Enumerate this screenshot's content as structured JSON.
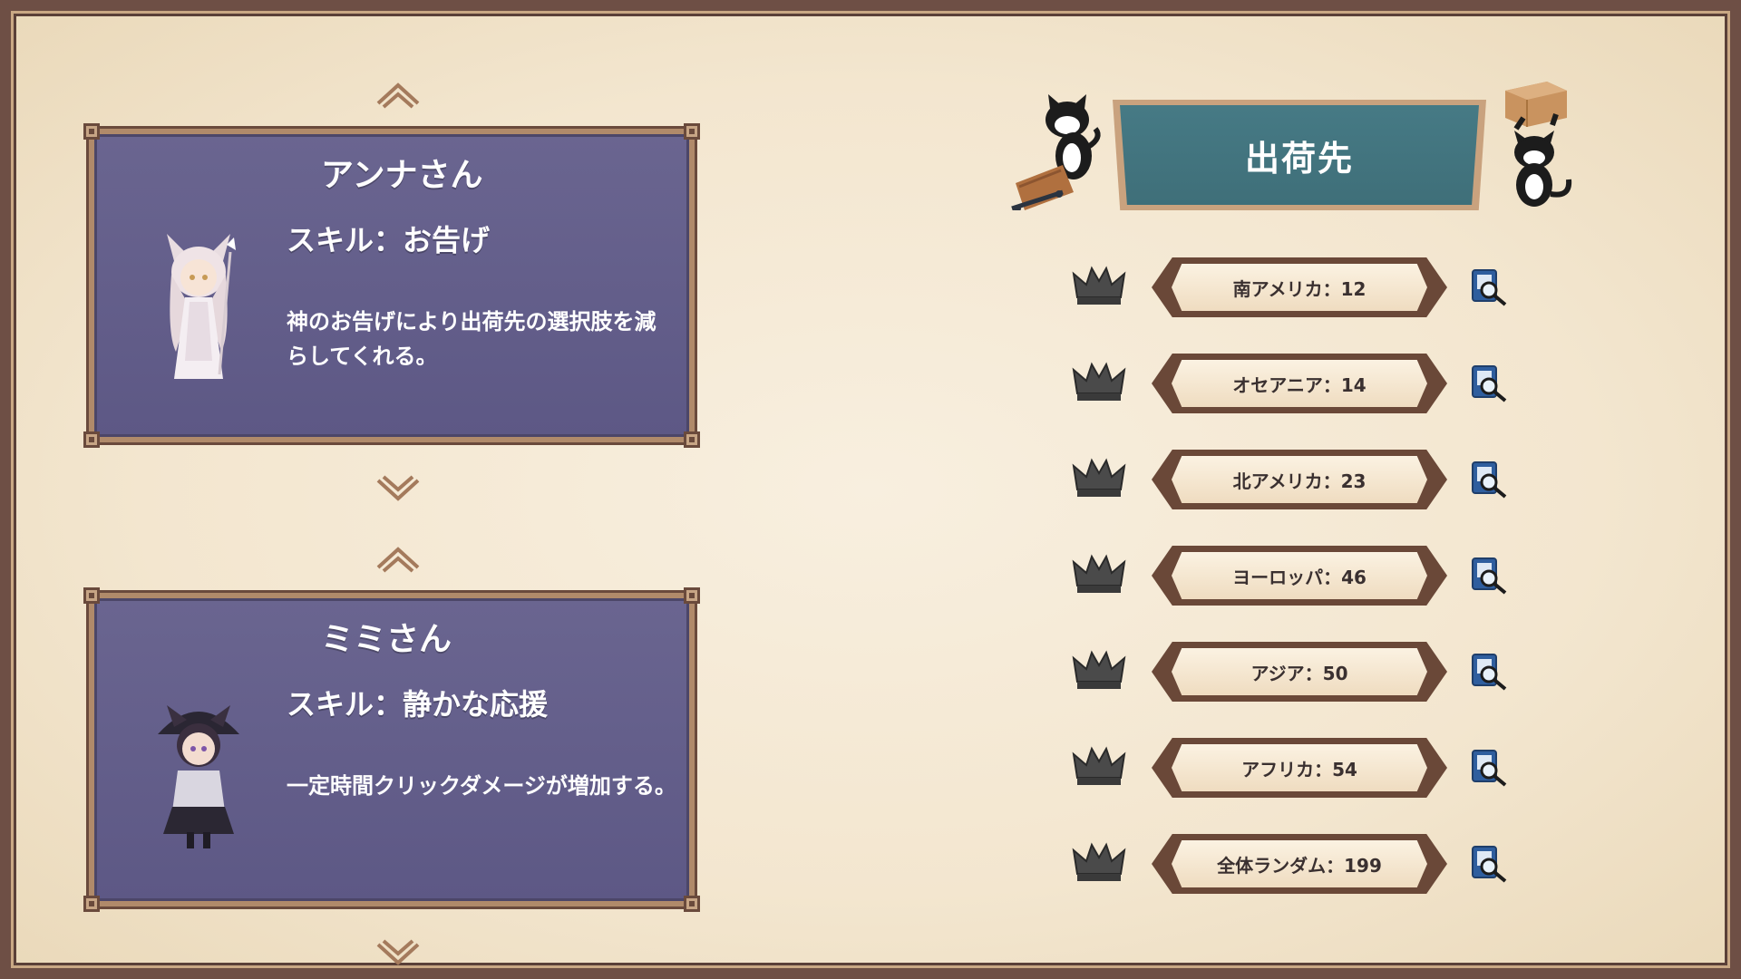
{
  "characters": [
    {
      "name": "アンナさん",
      "skill": "スキル：お告げ",
      "description": "神のお告げにより出荷先の選択肢を減らしてくれる。"
    },
    {
      "name": "ミミさん",
      "skill": "スキル：静かな応援",
      "description": "一定時間クリックダメージが増加する。"
    }
  ],
  "destination": {
    "title": "出荷先",
    "items": [
      {
        "label": "南アメリカ：12"
      },
      {
        "label": "オセアニア：14"
      },
      {
        "label": "北アメリカ：23"
      },
      {
        "label": "ヨーロッパ：46"
      },
      {
        "label": "アジア：50"
      },
      {
        "label": "アフリカ：54"
      },
      {
        "label": "全体ランダム：199"
      }
    ]
  },
  "icons": {
    "arrow_up": "chevron-up-icon",
    "arrow_down": "chevron-down-icon",
    "crown": "crown-icon",
    "info": "book-search-icon"
  },
  "colors": {
    "background": "#f3e6cf",
    "panel": "#615c88",
    "header": "#437480",
    "frame": "#6e4f45"
  }
}
